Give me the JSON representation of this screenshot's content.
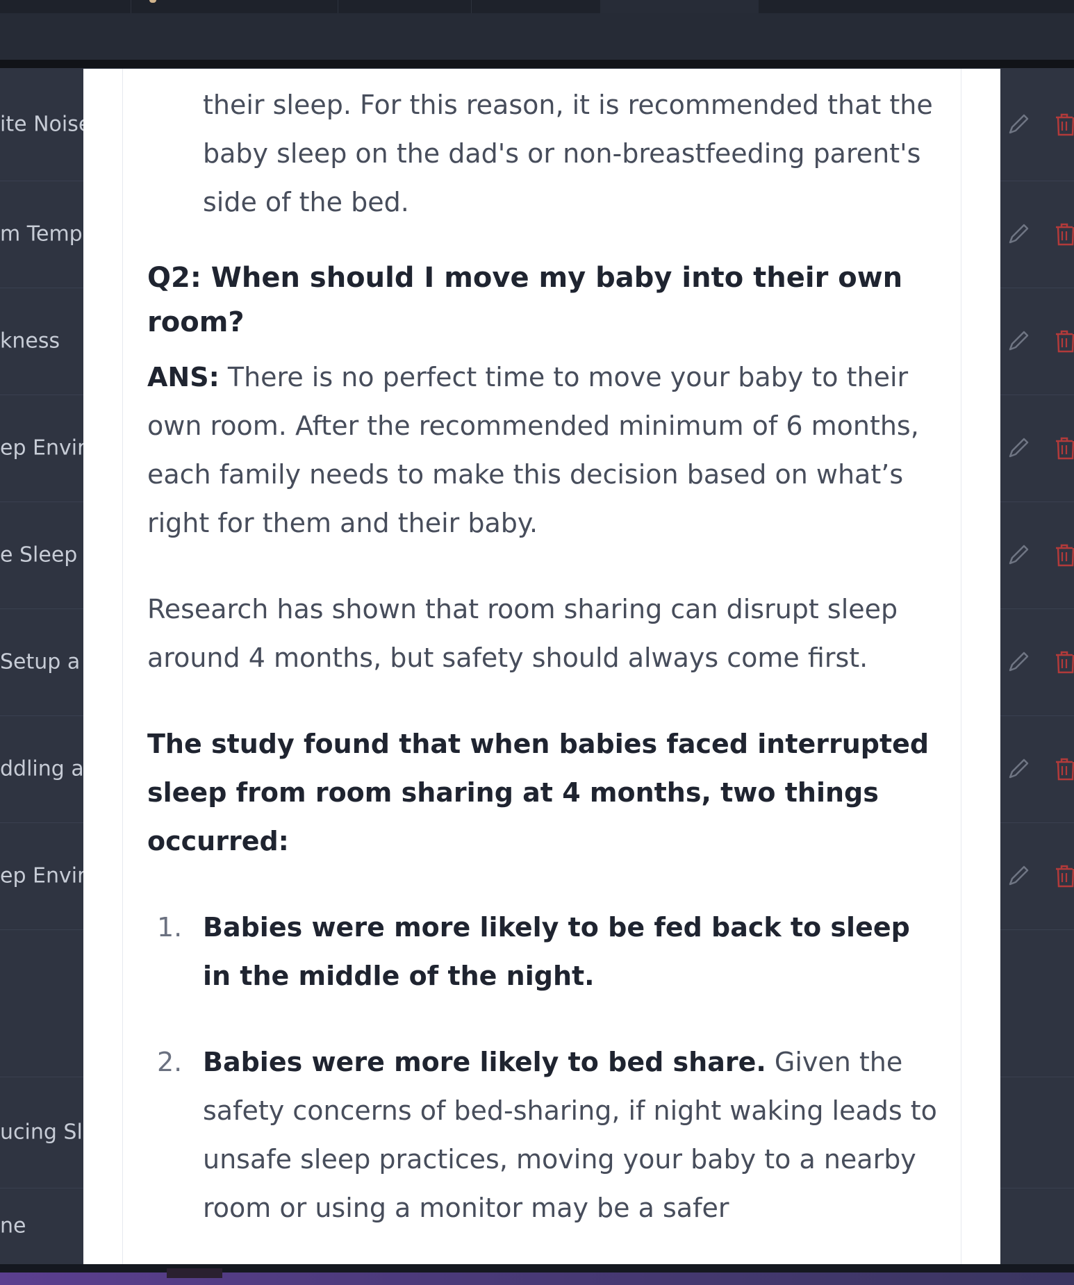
{
  "background": {
    "rows": [
      {
        "label": "ite Noise"
      },
      {
        "label": "m Temp"
      },
      {
        "label": "kness"
      },
      {
        "label": "ep Envir"
      },
      {
        "label": "e Sleep C"
      },
      {
        "label": "Setup a"
      },
      {
        "label": "ddling a"
      },
      {
        "label": "ep Envir"
      },
      {
        "label": ""
      },
      {
        "label": "ucing Sl"
      },
      {
        "label": "ne"
      }
    ],
    "edit_icon": "pencil-icon",
    "delete_icon": "trash-icon",
    "delete_color": "#b23a3a"
  },
  "modal": {
    "intro_continued": "their sleep. For this reason, it is recommended that the baby sleep on the dad's or non-breastfeeding parent's side of the bed.",
    "question": "Q2: When should I move my baby into their own room?",
    "answer_label": "ANS:",
    "answer_text": " There is no perfect time to move your baby to their own room. After the recommended minimum of 6 months, each family needs to make this decision based on what’s right for them and their baby.",
    "research_text": "Research has shown that room sharing can disrupt sleep around 4 months, but safety should always come first.",
    "study_heading": "The study found that when babies faced interrupted sleep from room sharing at 4 months, two things occurred:",
    "list": [
      {
        "num": "1.",
        "bold": "Babies were more likely to be fed back to sleep in the middle of the night.",
        "text": ""
      },
      {
        "num": "2.",
        "bold": "Babies were more likely to bed share.",
        "text": " Given the safety concerns of bed-sharing, if night waking leads to unsafe sleep practices, moving your baby to a nearby room or using a monitor may be a safer"
      }
    ]
  }
}
